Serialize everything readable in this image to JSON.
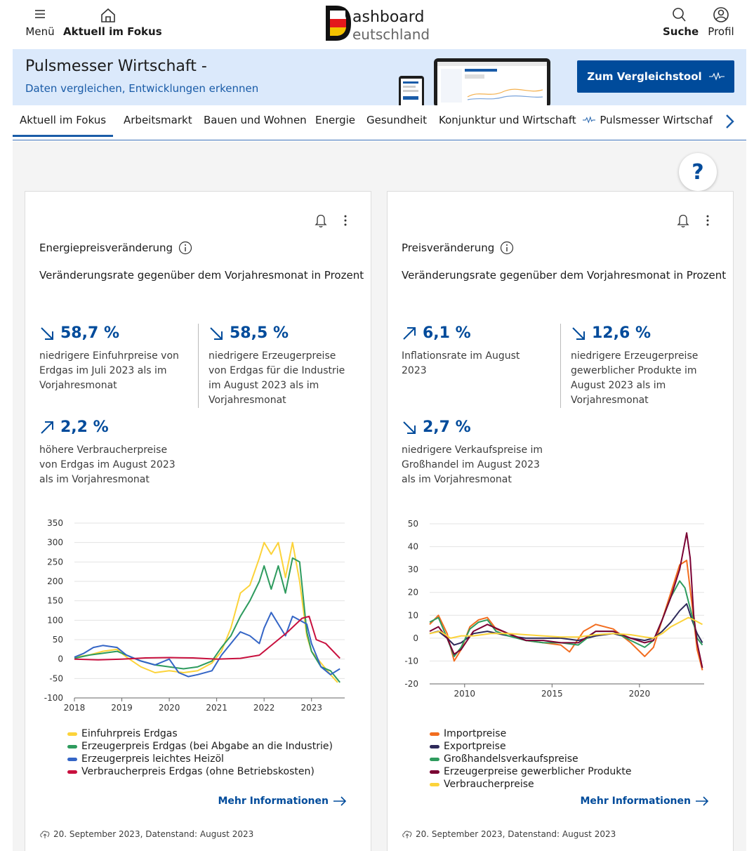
{
  "header": {
    "menu_label": "Menü",
    "focus_label": "Aktuell im Fokus",
    "logo_line1": "ashboard",
    "logo_line2": "eutschland",
    "search_label": "Suche",
    "profile_label": "Profil"
  },
  "banner": {
    "title": "Pulsmesser Wirtschaft -",
    "subtitle": "Daten vergleichen, Entwicklungen erkennen",
    "button_label": "Zum Vergleichstool"
  },
  "nav": {
    "tabs": [
      "Aktuell im Fokus",
      "Arbeitsmarkt",
      "Bauen und Wohnen",
      "Energie",
      "Gesundheit",
      "Konjunktur und Wirtschaft",
      "Pulsmesser Wirtschaf"
    ]
  },
  "help_label": "?",
  "cards": [
    {
      "title": "Energiepreisveränderung",
      "subtitle": "Veränderungsrate gegenüber dem Vorjahresmonat in Prozent",
      "kpis": [
        {
          "value": "58,7 %",
          "trend": "down",
          "desc": "niedrigere Einfuhrpreise von Erdgas im Juli 2023 als im Vorjahresmonat"
        },
        {
          "value": "58,5 %",
          "trend": "down",
          "desc": "niedrigere Erzeugerpreise von Erdgas für die Industrie im August 2023 als im Vorjahresmonat"
        },
        {
          "value": "2,2 %",
          "trend": "up",
          "desc": "höhere Verbraucherpreise von Erdgas im August 2023 als im Vorjahresmonat"
        }
      ],
      "more_label": "Mehr Informationen",
      "footer": "20. September 2023, Datenstand: August 2023"
    },
    {
      "title": "Preisveränderung",
      "subtitle": "Veränderungsrate gegenüber dem Vorjahresmonat in Prozent",
      "kpis": [
        {
          "value": "6,1 %",
          "trend": "up",
          "desc": "Inflationsrate im August 2023"
        },
        {
          "value": "12,6 %",
          "trend": "down",
          "desc": "niedrigere Erzeugerpreise gewerblicher Produkte im August 2023 als im Vorjahresmonat"
        },
        {
          "value": "2,7 %",
          "trend": "down",
          "desc": "niedrigere Verkaufspreise im Großhandel im August 2023 als im Vorjahresmonat"
        }
      ],
      "more_label": "Mehr Informationen",
      "footer": "20. September 2023, Datenstand: August 2023"
    }
  ],
  "colors": {
    "primary": "#004b9b",
    "banner_bg": "#dbe9fb",
    "link": "#1a5ca8"
  },
  "chart_data": [
    {
      "type": "line",
      "title": "",
      "xlabel": "",
      "ylabel": "",
      "xlim": [
        2018,
        2023.7
      ],
      "ylim": [
        -100,
        350
      ],
      "yticks": [
        -100,
        -50,
        0,
        50,
        100,
        150,
        200,
        250,
        300,
        350
      ],
      "xticks": [
        2018,
        2019,
        2020,
        2021,
        2022,
        2023
      ],
      "grid": true,
      "legend_position": "bottom",
      "series": [
        {
          "name": "Einfuhrpreis Erdgas",
          "color": "#fcd33a",
          "x": [
            2018,
            2018.3,
            2018.6,
            2018.9,
            2019.1,
            2019.4,
            2019.7,
            2020,
            2020.3,
            2020.6,
            2020.9,
            2021.1,
            2021.3,
            2021.5,
            2021.7,
            2021.9,
            2022,
            2022.15,
            2022.3,
            2022.45,
            2022.6,
            2022.75,
            2022.9,
            2023,
            2023.2,
            2023.4,
            2023.55
          ],
          "y": [
            5,
            10,
            20,
            25,
            5,
            -20,
            -35,
            -30,
            -35,
            -30,
            -10,
            20,
            80,
            170,
            190,
            260,
            300,
            270,
            300,
            210,
            300,
            200,
            60,
            20,
            -10,
            -40,
            -60
          ]
        },
        {
          "name": "Erzeugerpreis Erdgas (bei Abgabe an die Industrie)",
          "color": "#2e9b5e",
          "x": [
            2018,
            2018.3,
            2018.6,
            2018.9,
            2019.1,
            2019.4,
            2019.7,
            2020,
            2020.3,
            2020.6,
            2020.9,
            2021.1,
            2021.3,
            2021.5,
            2021.7,
            2021.9,
            2022,
            2022.15,
            2022.3,
            2022.45,
            2022.6,
            2022.75,
            2022.9,
            2023,
            2023.2,
            2023.4,
            2023.6
          ],
          "y": [
            2,
            10,
            15,
            20,
            10,
            -5,
            -15,
            -20,
            -25,
            -20,
            -5,
            30,
            60,
            110,
            150,
            200,
            240,
            180,
            240,
            170,
            260,
            250,
            70,
            20,
            -20,
            -30,
            -60
          ]
        },
        {
          "name": "Erzeugerpreis leichtes Heizöl",
          "color": "#3465c6",
          "x": [
            2018,
            2018.2,
            2018.4,
            2018.6,
            2018.9,
            2019.1,
            2019.4,
            2019.7,
            2020,
            2020.2,
            2020.4,
            2020.6,
            2020.9,
            2021.1,
            2021.3,
            2021.5,
            2021.7,
            2021.9,
            2022,
            2022.15,
            2022.3,
            2022.45,
            2022.6,
            2022.75,
            2022.9,
            2023,
            2023.2,
            2023.4,
            2023.6
          ],
          "y": [
            5,
            15,
            30,
            35,
            30,
            10,
            -5,
            -15,
            0,
            -35,
            -45,
            -40,
            -30,
            10,
            40,
            70,
            60,
            40,
            80,
            120,
            90,
            60,
            110,
            100,
            90,
            40,
            -20,
            -40,
            -25
          ]
        },
        {
          "name": "Verbraucherpreis Erdgas (ohne Betriebskosten)",
          "color": "#c8103e",
          "x": [
            2018,
            2018.5,
            2019,
            2019.5,
            2020,
            2020.5,
            2021,
            2021.5,
            2021.9,
            2022.2,
            2022.5,
            2022.8,
            2022.95,
            2023.1,
            2023.3,
            2023.6
          ],
          "y": [
            0,
            -2,
            0,
            3,
            4,
            3,
            0,
            2,
            10,
            40,
            70,
            105,
            110,
            50,
            40,
            2
          ]
        }
      ]
    },
    {
      "type": "line",
      "title": "",
      "xlabel": "",
      "ylabel": "",
      "xlim": [
        2008,
        2023.7
      ],
      "ylim": [
        -20,
        50
      ],
      "yticks": [
        -20,
        -10,
        0,
        10,
        20,
        30,
        40,
        50
      ],
      "xticks": [
        2010,
        2015,
        2020
      ],
      "grid": true,
      "legend_position": "bottom",
      "series": [
        {
          "name": "Importpreise",
          "color": "#f26d1f",
          "x": [
            2008,
            2008.5,
            2009,
            2009.4,
            2009.8,
            2010.3,
            2010.8,
            2011.3,
            2011.8,
            2012.5,
            2013.5,
            2014.5,
            2015.5,
            2016,
            2016.8,
            2017.5,
            2018.5,
            2019.5,
            2020.3,
            2020.8,
            2021.3,
            2021.8,
            2022.3,
            2022.7,
            2023,
            2023.3,
            2023.6
          ],
          "y": [
            6,
            10,
            2,
            -10,
            -5,
            5,
            8,
            9,
            4,
            2,
            -1,
            -2,
            -3,
            -6,
            3,
            6,
            4,
            -2,
            -8,
            -4,
            8,
            20,
            32,
            34,
            15,
            -5,
            -14
          ]
        },
        {
          "name": "Exportpreise",
          "color": "#2e2a5a",
          "x": [
            2008,
            2008.5,
            2009,
            2009.4,
            2009.8,
            2010.5,
            2011.3,
            2012.5,
            2013.5,
            2014.5,
            2015.5,
            2016.5,
            2017.5,
            2018.5,
            2019.5,
            2020.3,
            2020.8,
            2021.3,
            2021.8,
            2022.3,
            2022.7,
            2023,
            2023.3,
            2023.6
          ],
          "y": [
            2,
            3,
            0,
            -3,
            -2,
            2,
            3,
            1,
            0,
            0,
            0,
            -1,
            1,
            2,
            0,
            -1,
            0,
            3,
            7,
            12,
            15,
            8,
            2,
            -2
          ]
        },
        {
          "name": "Großhandelsverkaufspreise",
          "color": "#2e9b5e",
          "x": [
            2008,
            2008.5,
            2009,
            2009.4,
            2009.8,
            2010.3,
            2010.8,
            2011.3,
            2011.8,
            2012.5,
            2013.5,
            2014.5,
            2015.5,
            2016.5,
            2017.5,
            2018.5,
            2019.5,
            2020.3,
            2020.8,
            2021.3,
            2021.8,
            2022.3,
            2022.6,
            2023,
            2023.3,
            2023.6
          ],
          "y": [
            7,
            9,
            0,
            -8,
            -4,
            4,
            7,
            8,
            3,
            1,
            -1,
            -2,
            -2,
            -3,
            3,
            3,
            -1,
            -4,
            -1,
            8,
            18,
            25,
            22,
            10,
            0,
            -3
          ]
        },
        {
          "name": "Erzeugerpreise gewerblicher Produkte",
          "color": "#7a0033",
          "x": [
            2008,
            2008.5,
            2009,
            2009.4,
            2009.8,
            2010.5,
            2011.3,
            2012.5,
            2013.5,
            2014.5,
            2015.5,
            2016.5,
            2017.5,
            2018.5,
            2019.5,
            2020.3,
            2020.8,
            2021.3,
            2021.8,
            2022.3,
            2022.7,
            2022.9,
            2023.1,
            2023.3,
            2023.6
          ],
          "y": [
            3,
            5,
            0,
            -7,
            -5,
            3,
            6,
            2,
            -1,
            -1,
            -2,
            -2,
            3,
            3,
            0,
            -2,
            -1,
            8,
            18,
            30,
            46,
            35,
            10,
            -2,
            -13
          ]
        },
        {
          "name": "Verbraucherpreise",
          "color": "#fcd33a",
          "x": [
            2008,
            2008.6,
            2009.2,
            2009.8,
            2010.5,
            2011.5,
            2012.5,
            2013.5,
            2014.5,
            2015.5,
            2016.5,
            2017.5,
            2018.5,
            2019.5,
            2020.3,
            2020.8,
            2021.3,
            2021.8,
            2022.3,
            2022.8,
            2023.1,
            2023.6
          ],
          "y": [
            2,
            3,
            0,
            1,
            1,
            2,
            2,
            1.5,
            1,
            0.5,
            0.5,
            1.5,
            2,
            1.5,
            0.5,
            0,
            2,
            5,
            7,
            9,
            8,
            6
          ]
        }
      ]
    }
  ]
}
